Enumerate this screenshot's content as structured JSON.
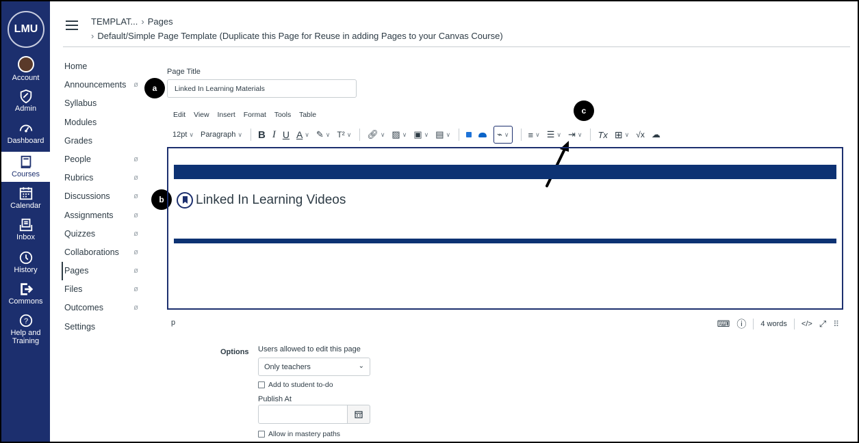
{
  "global_nav": {
    "logo_text": "LMU",
    "items": [
      {
        "label": "Account",
        "icon": "avatar"
      },
      {
        "label": "Admin",
        "icon": "shield-icon"
      },
      {
        "label": "Dashboard",
        "icon": "dashboard-icon"
      },
      {
        "label": "Courses",
        "icon": "book-icon"
      },
      {
        "label": "Calendar",
        "icon": "calendar-icon"
      },
      {
        "label": "Inbox",
        "icon": "inbox-icon"
      },
      {
        "label": "History",
        "icon": "clock-icon"
      },
      {
        "label": "Commons",
        "icon": "commons-icon"
      },
      {
        "label": "Help and Training",
        "icon": "help-icon"
      }
    ],
    "active": "Courses",
    "colors": {
      "background": "#1c2f6e"
    }
  },
  "breadcrumb": {
    "course": "TEMPLAT...",
    "section": "Pages",
    "page": "Default/Simple Page Template (Duplicate this Page for Reuse in adding Pages to your Canvas Course)"
  },
  "course_nav": [
    {
      "label": "Home",
      "hidden": false
    },
    {
      "label": "Announcements",
      "hidden": true
    },
    {
      "label": "Syllabus",
      "hidden": false
    },
    {
      "label": "Modules",
      "hidden": false
    },
    {
      "label": "Grades",
      "hidden": false
    },
    {
      "label": "People",
      "hidden": true
    },
    {
      "label": "Rubrics",
      "hidden": true
    },
    {
      "label": "Discussions",
      "hidden": true
    },
    {
      "label": "Assignments",
      "hidden": true
    },
    {
      "label": "Quizzes",
      "hidden": true
    },
    {
      "label": "Collaborations",
      "hidden": true
    },
    {
      "label": "Pages",
      "hidden": true,
      "active": true
    },
    {
      "label": "Files",
      "hidden": true
    },
    {
      "label": "Outcomes",
      "hidden": true
    },
    {
      "label": "Settings",
      "hidden": false
    }
  ],
  "page_title": {
    "label": "Page Title",
    "value": "Linked In Learning Materials"
  },
  "editor": {
    "menubar": [
      "Edit",
      "View",
      "Insert",
      "Format",
      "Tools",
      "Table"
    ],
    "font_size": "12pt",
    "block_format": "Paragraph",
    "heading_text": "Linked In Learning Videos",
    "band_color": "#0d3273",
    "status_path": "p",
    "word_count": "4 words",
    "html_toggle": "</>"
  },
  "markers": {
    "a": "a",
    "b": "b",
    "c": "c"
  },
  "options": {
    "label": "Options",
    "edit_label": "Users allowed to edit this page",
    "edit_value": "Only teachers",
    "todo_label": "Add to student to-do",
    "publish_label": "Publish At",
    "mastery_label": "Allow in mastery paths"
  }
}
